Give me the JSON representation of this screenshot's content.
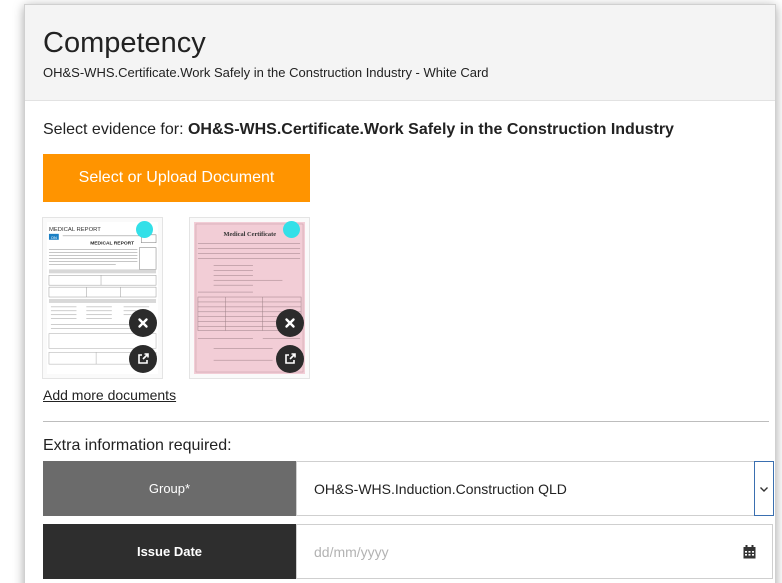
{
  "header": {
    "title": "Competency",
    "subtitle": "OH&S-WHS.Certificate.Work Safely in the Construction Industry - White Card"
  },
  "evidence": {
    "prefix": "Select evidence for: ",
    "name": "OH&S-WHS.Certificate.Work Safely in the Construction Industry",
    "upload_label": "Select or Upload Document",
    "documents": [
      {
        "heading": "MEDICAL REPORT",
        "title": "MEDICAL REPORT",
        "badge": "ON"
      },
      {
        "title": "Medical Certificate"
      }
    ],
    "add_more": "Add more documents"
  },
  "extra": {
    "label": "Extra information required:",
    "group": {
      "label": "Group",
      "required_mark": "*",
      "value": "OH&S-WHS.Induction.Construction QLD"
    },
    "issue_date": {
      "label": "Issue Date",
      "placeholder": "dd/mm/yyyy"
    }
  },
  "colors": {
    "accent": "#ff9400",
    "doc_dot": "#33e0e8"
  },
  "icons": {
    "remove": "close-icon",
    "open": "external-link-icon",
    "dropdown": "chevron-down-icon",
    "date": "calendar-icon"
  }
}
